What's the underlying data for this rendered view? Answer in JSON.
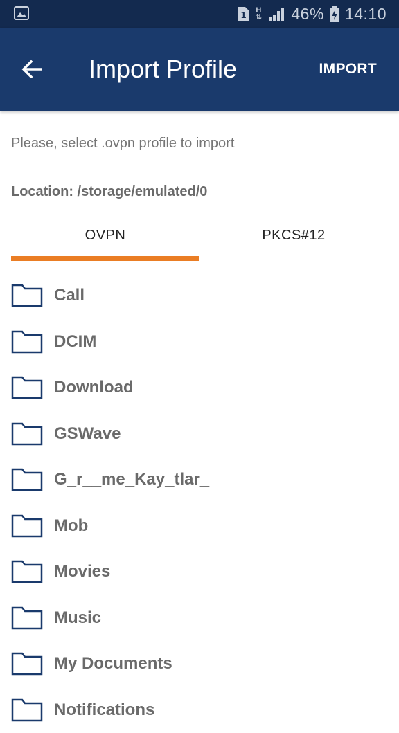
{
  "status_bar": {
    "battery_percent": "46%",
    "time": "14:10",
    "network_type": "H",
    "sim_slot": "1"
  },
  "app_bar": {
    "title": "Import Profile",
    "import_label": "IMPORT"
  },
  "hint_text": "Please, select .ovpn profile to import",
  "location_text": "Location: /storage/emulated/0",
  "tabs": [
    {
      "label": "OVPN",
      "selected": true
    },
    {
      "label": "PKCS#12",
      "selected": false
    }
  ],
  "files": [
    {
      "name": "Call"
    },
    {
      "name": "DCIM"
    },
    {
      "name": "Download"
    },
    {
      "name": "GSWave"
    },
    {
      "name": "G_r__me_Kay_tlar_"
    },
    {
      "name": "Mob"
    },
    {
      "name": "Movies"
    },
    {
      "name": "Music"
    },
    {
      "name": "My Documents"
    },
    {
      "name": "Notifications"
    }
  ],
  "colors": {
    "status_bar": "#132a4f",
    "app_bar": "#1a3a6c",
    "tab_indicator": "#ea7d24",
    "folder_icon": "#1a3a6c"
  }
}
